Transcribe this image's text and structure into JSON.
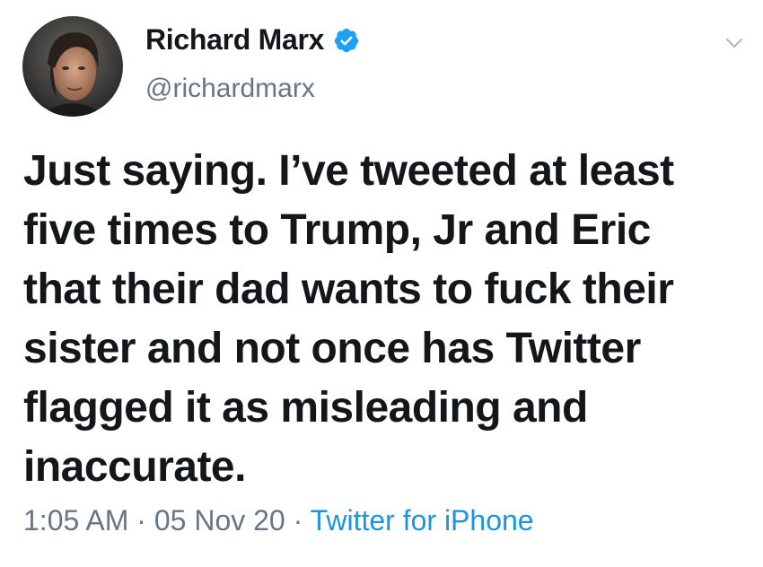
{
  "author": {
    "display_name": "Richard Marx",
    "handle": "@richardmarx",
    "verified": true,
    "avatar_icon": "avatar-portrait"
  },
  "tweet": {
    "text": "Just saying. I’ve tweeted at least\nfive times to Trump, Jr and Eric\nthat their dad wants to fuck their\nsister and not once has Twitter\nflagged it as misleading and\ninaccurate."
  },
  "meta": {
    "time": "1:05 AM",
    "separator": "·",
    "date": "05 Nov 20",
    "source": "Twitter for iPhone"
  },
  "colors": {
    "text": "#14171a",
    "secondary": "#657786",
    "link": "#1b95e0",
    "verified": "#1da1f2"
  },
  "icons": {
    "verified": "verified-badge-icon",
    "menu": "chevron-down-icon"
  }
}
